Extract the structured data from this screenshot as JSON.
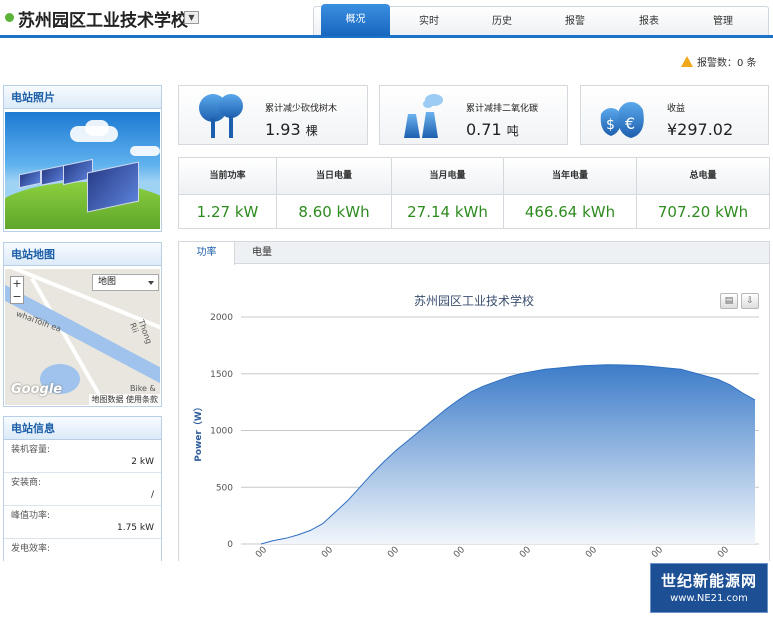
{
  "header": {
    "site_title": "苏州园区工业技术学校",
    "dropdown_glyph": "▼",
    "tabs": [
      {
        "label": "概况",
        "active": true
      },
      {
        "label": "实时",
        "active": false
      },
      {
        "label": "历史",
        "active": false
      },
      {
        "label": "报警",
        "active": false
      },
      {
        "label": "报表",
        "active": false
      },
      {
        "label": "管理",
        "active": false
      }
    ]
  },
  "alarm": {
    "text": "报警数：0 条"
  },
  "left": {
    "photo_title": "电站照片",
    "map_title": "电站地图",
    "map": {
      "type_label": "地图",
      "zoom_in": "+",
      "zoom_out": "−",
      "logo": "Google",
      "credits": "地图数据  使用条款",
      "labels": [
        "Thong Rii",
        "Bike &"
      ]
    },
    "info_title": "电站信息",
    "info_rows": [
      {
        "label": "装机容量:",
        "value": "2 kW"
      },
      {
        "label": "安装商:",
        "value": "/"
      },
      {
        "label": "峰值功率:",
        "value": "1.75 kW"
      },
      {
        "label": "发电效率:",
        "value": ""
      }
    ]
  },
  "cards": [
    {
      "label": "累计减少砍伐树木",
      "value": "1.93",
      "unit": "棵",
      "icon": "tree-icon"
    },
    {
      "label": "累计减排二氧化碳",
      "value": "0.71",
      "unit": "吨",
      "icon": "factory-icon"
    },
    {
      "label": "收益",
      "value": "¥297.02",
      "unit": "",
      "icon": "money-bag-icon"
    }
  ],
  "stats": [
    {
      "label": "当前功率",
      "value": "1.27 kW"
    },
    {
      "label": "当日电量",
      "value": "8.60 kWh"
    },
    {
      "label": "当月电量",
      "value": "27.14 kWh"
    },
    {
      "label": "当年电量",
      "value": "466.64 kWh"
    },
    {
      "label": "总电量",
      "value": "707.20 kWh"
    }
  ],
  "chart_tabs": [
    {
      "label": "功率",
      "active": true
    },
    {
      "label": "电量",
      "active": false
    }
  ],
  "chart_data": {
    "type": "area",
    "title": "苏州园区工业技术学校",
    "xlabel": "",
    "ylabel": "Power（W）",
    "ylim": [
      0,
      2000
    ],
    "yticks": [
      0,
      500,
      1000,
      1500,
      2000
    ],
    "grid": true,
    "x_tick_labels": [
      "00",
      "00",
      "00",
      "00",
      "00",
      "00",
      "00",
      "00"
    ],
    "series": [
      {
        "values": [
          0,
          30,
          50,
          80,
          120,
          180,
          280,
          380,
          500,
          620,
          730,
          830,
          920,
          1010,
          1100,
          1190,
          1270,
          1340,
          1390,
          1430,
          1470,
          1500,
          1520,
          1540,
          1550,
          1560,
          1570,
          1575,
          1580,
          1578,
          1575,
          1570,
          1560,
          1550,
          1540,
          1510,
          1480,
          1450,
          1400,
          1330,
          1270
        ]
      }
    ],
    "colors": {
      "fill_top": "#3d7cc9",
      "fill_bottom": "#f2f6fb",
      "line": "#2f6fc2"
    }
  },
  "watermark": {
    "line1": "世纪新能源网",
    "line2": "www.NE21.com"
  }
}
